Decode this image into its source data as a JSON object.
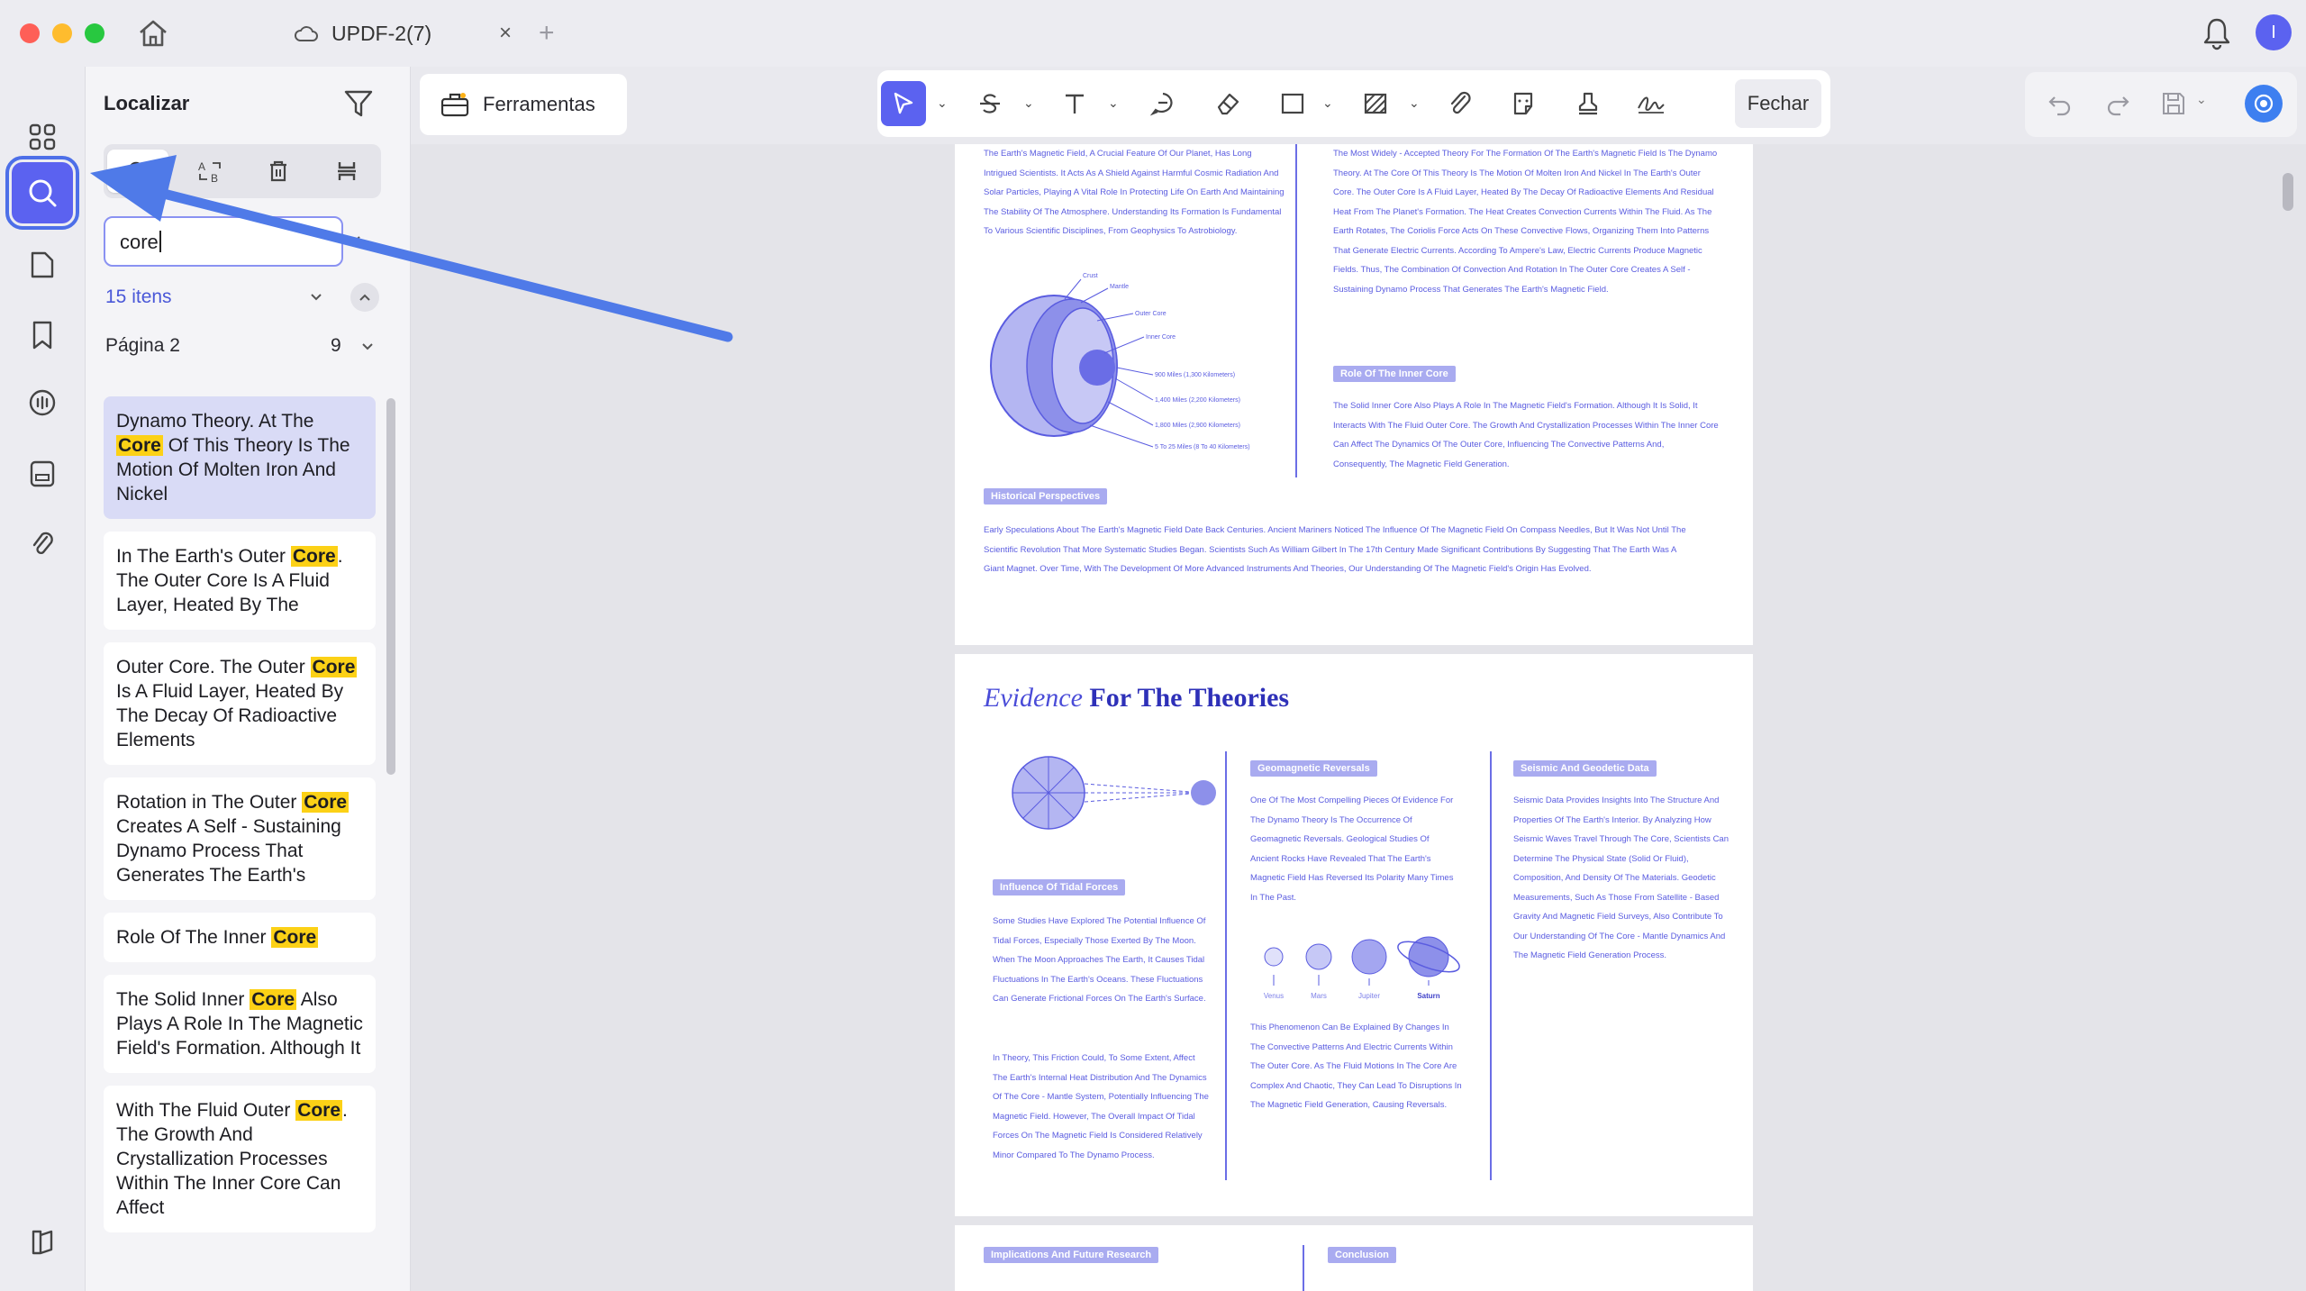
{
  "window": {
    "tab_title": "UPDF-2(7)",
    "tab_close": "×",
    "new_tab": "+",
    "avatar_letter": "I"
  },
  "search_panel": {
    "title": "Localizar",
    "query": "core",
    "result_count": "15 itens",
    "page_label": "Página 2",
    "page_hits": "9",
    "results": [
      {
        "before": "Dynamo Theory. At The ",
        "match": "Core",
        "after": " Of This Theory Is The Motion Of Molten Iron And Nickel"
      },
      {
        "before": "In The Earth's Outer ",
        "match": "Core",
        "after": ". The Outer Core Is A Fluid Layer, Heated By The"
      },
      {
        "before": "Outer Core. The Outer ",
        "match": "Core",
        "after": " Is A Fluid Layer, Heated By The Decay Of Radioactive Elements"
      },
      {
        "before": "Rotation in The Outer ",
        "match": "Core",
        "after": " Creates A Self - Sustaining Dynamo Process That Generates The Earth's"
      },
      {
        "before": "Role Of The Inner ",
        "match": "Core",
        "after": ""
      },
      {
        "before": "The Solid Inner ",
        "match": "Core",
        "after": " Also Plays A Role In The Magnetic Field's Formation. Although It"
      },
      {
        "before": "With The Fluid Outer ",
        "match": "Core",
        "after": ". The Growth And Crystallization Processes Within The Inner Core Can Affect"
      }
    ]
  },
  "toolbar": {
    "tools_label": "Ferramentas",
    "close_label": "Fechar"
  },
  "document": {
    "page1": {
      "col1_text": "The Earth's Magnetic Field, A Crucial Feature Of Our Planet, Has Long Intrigued Scientists. It Acts As A Shield Against Harmful Cosmic Radiation And Solar Particles, Playing A Vital Role In Protecting Life On Earth And Maintaining The Stability Of The Atmosphere. Understanding Its Formation Is Fundamental To Various Scientific Disciplines, From Geophysics To Astrobiology.",
      "col2_text": "The Most Widely - Accepted Theory For The Formation Of The Earth's Magnetic Field Is The Dynamo Theory. At The Core Of This Theory Is The Motion Of Molten Iron And Nickel In The Earth's Outer Core. The Outer Core Is A Fluid Layer, Heated By The Decay Of Radioactive Elements And Residual Heat From The Planet's Formation. The Heat Creates Convection Currents Within The Fluid. As The Earth Rotates, The Coriolis Force Acts On These Convective Flows, Organizing Them Into Patterns That Generate Electric Currents. According To Ampere's Law, Electric Currents Produce Magnetic Fields. Thus, The Combination Of Convection And Rotation In The Outer Core Creates A Self - Sustaining Dynamo Process That Generates The Earth's Magnetic Field.",
      "inner_core_badge": "Role Of The Inner Core",
      "inner_core_text": "The Solid Inner Core Also Plays A Role In The Magnetic Field's Formation. Although It Is Solid, It Interacts With The Fluid Outer Core. The Growth And Crystallization Processes Within The Inner Core Can Affect The Dynamics Of The Outer Core, Influencing The Convective Patterns And, Consequently, The Magnetic Field Generation.",
      "diagram_labels": [
        "Crust",
        "Mantle",
        "Outer Core",
        "Inner Core",
        "900 Miles (1,300 Kilometers)",
        "1,400 Miles (2,200 Kilometers)",
        "1,800 Miles (2,900 Kilometers)",
        "5 To 25 Miles (8 To 40 Kilometers)"
      ],
      "history_badge": "Historical Perspectives",
      "history_text": "Early Speculations About The Earth's Magnetic Field Date Back Centuries. Ancient Mariners Noticed The Influence Of The Magnetic Field On Compass Needles, But It Was Not Until The Scientific Revolution That More Systematic Studies Began. Scientists Such As William Gilbert In The 17th Century Made Significant Contributions By Suggesting That The Earth Was A Giant Magnet. Over Time, With The Development Of More Advanced Instruments And Theories, Our Understanding Of The Magnetic Field's Origin Has Evolved."
    },
    "page2": {
      "title_italic": "Evidence",
      "title_rest": " For The Theories",
      "geo_badge": "Geomagnetic Reversals",
      "geo_text": "One Of The Most Compelling Pieces Of Evidence For The Dynamo Theory Is The Occurrence Of Geomagnetic Reversals. Geological Studies Of Ancient Rocks Have Revealed That The Earth's Magnetic Field Has Reversed Its Polarity Many Times In The Past.",
      "seismic_badge": "Seismic And Geodetic Data",
      "seismic_text": "Seismic Data Provides Insights Into The Structure And Properties Of The Earth's Interior. By Analyzing How Seismic Waves Travel Through The Core, Scientists Can Determine The Physical State (Solid Or Fluid), Composition, And Density Of The Materials. Geodetic Measurements, Such As Those From Satellite - Based Gravity And Magnetic Field Surveys, Also Contribute To Our Understanding Of The Core - Mantle Dynamics And The Magnetic Field Generation Process.",
      "tidal_badge": "Influence Of Tidal Forces",
      "tidal_text": "Some Studies Have Explored The Potential Influence Of Tidal Forces, Especially Those Exerted By The Moon. When The Moon Approaches The Earth, It Causes Tidal Fluctuations In The Earth's Oceans. These Fluctuations Can Generate Frictional Forces On The Earth's Surface.",
      "tidal_text2": "In Theory, This Friction Could, To Some Extent, Affect The Earth's Internal Heat Distribution And The Dynamics Of The Core - Mantle System, Potentially Influencing The Magnetic Field. However, The Overall Impact Of Tidal Forces On The Magnetic Field Is Considered Relatively Minor Compared To The Dynamo Process.",
      "planets": [
        "Venus",
        "Mars",
        "Jupiter",
        "Saturn"
      ],
      "phenom_text": "This Phenomenon Can Be Explained By Changes In The Convective Patterns And Electric Currents Within The Outer Core. As The Fluid Motions In The Core Are Complex And Chaotic, They Can Lead To Disruptions In The Magnetic Field Generation, Causing Reversals."
    },
    "page3": {
      "implications_badge": "Implications And Future Research",
      "conclusion_badge": "Conclusion"
    }
  },
  "colors": {
    "accent": "#5b62f0",
    "highlight": "#fcd116",
    "doc_text": "#5a5ce0",
    "arrow": "#4f7ae8"
  }
}
